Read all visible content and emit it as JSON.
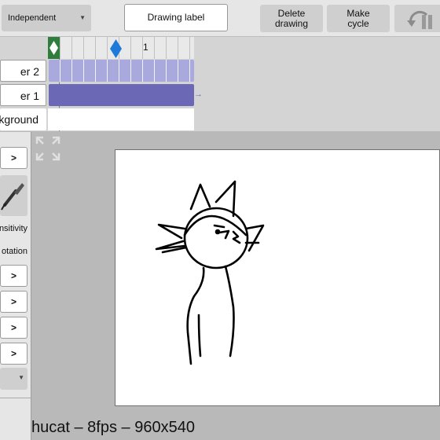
{
  "toolbar": {
    "mode_value": "Independent",
    "drawing_label_button": "Drawing label",
    "delete_button_line1": "Delete",
    "delete_button_line2": "drawing",
    "cycle_button_line1": "Make",
    "cycle_button_line2": "cycle"
  },
  "timeline": {
    "frame_marker": "1",
    "layers": [
      {
        "label": "er 2"
      },
      {
        "label": "er 1"
      },
      {
        "label": "kground"
      }
    ]
  },
  "left_panel": {
    "top_arrow": ">",
    "sensitivity_label": "nsitivity",
    "rotation_label": "otation",
    "arrows": [
      ">",
      ">",
      ">",
      ">"
    ]
  },
  "status": {
    "text": "hucat – 8fps – 960x540"
  },
  "colors": {
    "layer_light": "#a9a9de",
    "layer_dark": "#6b69b5",
    "keyframe_green": "#2f7d3c",
    "keyframe_blue": "#1e7ad8"
  }
}
